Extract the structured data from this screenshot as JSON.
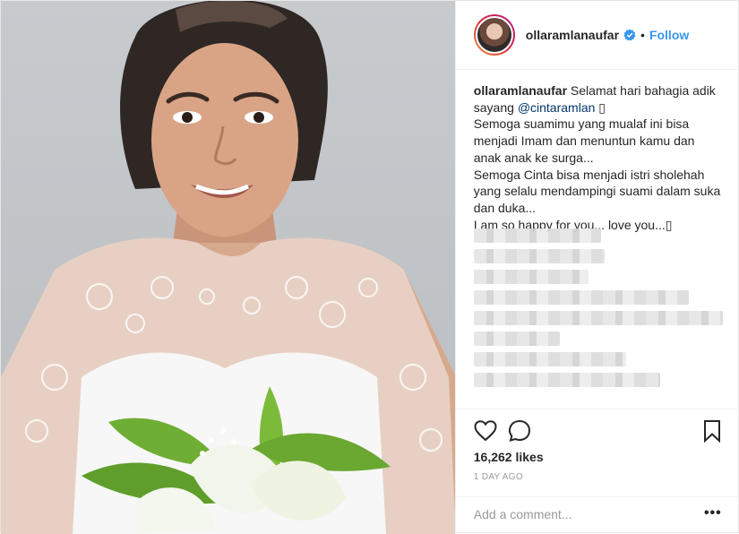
{
  "post": {
    "username": "ollaramlanaufar",
    "follow_label": "Follow",
    "separator": "•",
    "caption": {
      "author": "ollaramlanaufar",
      "line1_text": "Selamat hari bahagia adik sayang",
      "mention": "@cintaramlan",
      "glyph": "▯",
      "lines": [
        "Semoga suamimu yang mualaf ini bisa menjadi Imam dan menuntun kamu dan anak anak ke surga...",
        "Semoga Cinta bisa menjadi istri sholehah yang selalu mendampingi suami dalam suka dan duka...",
        "I am so happy for you... love you...▯"
      ]
    },
    "likes": "16,262 likes",
    "time_ago": "1 DAY AGO",
    "comment_placeholder": "Add a comment...",
    "more_label": "•••"
  },
  "colors": {
    "link": "#3897f0",
    "text": "#262626",
    "muted": "#999999"
  },
  "icons": [
    "verified-badge-icon",
    "heart-icon",
    "comment-icon",
    "bookmark-icon",
    "more-options-icon"
  ]
}
